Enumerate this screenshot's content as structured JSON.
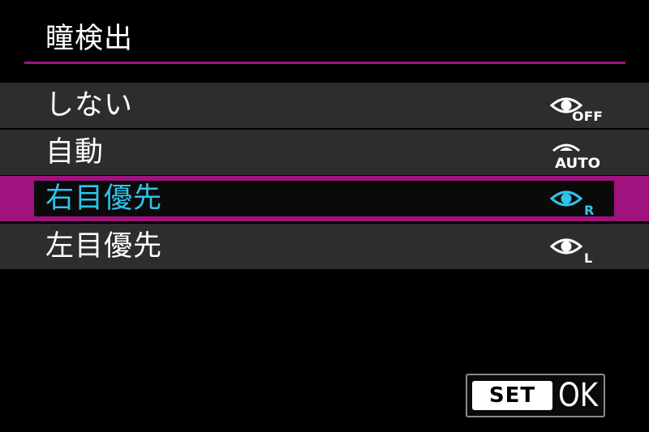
{
  "screen": {
    "title": "瞳検出"
  },
  "options": [
    {
      "label": "しない",
      "icon": "eye-off-icon",
      "icon_suffix": "OFF",
      "selected": false
    },
    {
      "label": "自動",
      "icon": "eye-auto-icon",
      "icon_suffix": "AUTO",
      "selected": false
    },
    {
      "label": "右目優先",
      "icon": "eye-right-icon",
      "icon_suffix": "R",
      "selected": true
    },
    {
      "label": "左目優先",
      "icon": "eye-left-icon",
      "icon_suffix": "L",
      "selected": false
    }
  ],
  "footer": {
    "set_label": "SET",
    "ok_label": "OK"
  },
  "colors": {
    "background": "#000000",
    "row_background": "#2d2d2d",
    "accent_magenta": "#a0127e",
    "selected_text": "#2fc4e8",
    "text": "#ffffff"
  }
}
